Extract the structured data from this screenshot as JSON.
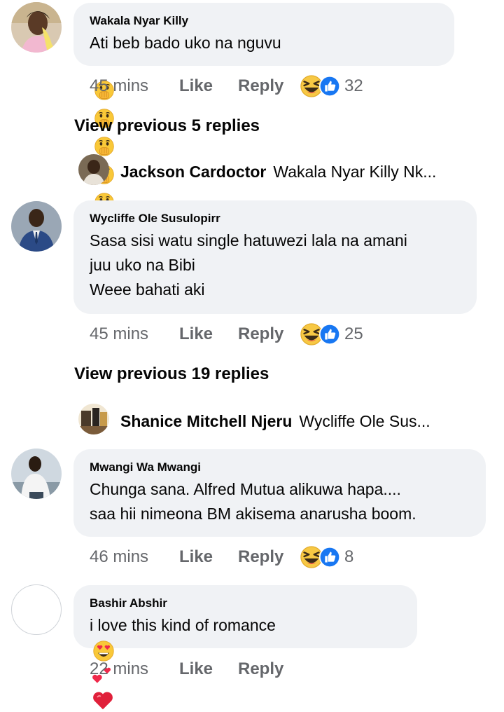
{
  "comments": [
    {
      "name": "Wakala Nyar Killy",
      "text": "Ati beb bado uko na nguvu",
      "emoji_note": "face-with-hand-over-mouth x5",
      "time": "45 mins",
      "like": "Like",
      "reply": "Reply",
      "reaction_count": "32"
    },
    {
      "name": "Wycliffe Ole Susulopirr",
      "text": "Sasa sisi watu single hatuwezi lala na amani\njuu uko na Bibi\nWeee bahati aki",
      "time": "45 mins",
      "like": "Like",
      "reply": "Reply",
      "reaction_count": "25"
    },
    {
      "name": "Mwangi Wa Mwangi",
      "text": "Chunga sana. Alfred Mutua alikuwa hapa....\nsaa hii nimeona BM akisema anarusha boom.",
      "time": "46 mins",
      "like": "Like",
      "reply": "Reply",
      "reaction_count": "8"
    },
    {
      "name": "Bashir Abshir",
      "text": "i love this kind of romance",
      "time": "22 mins",
      "like": "Like",
      "reply": "Reply"
    }
  ],
  "view_previous": [
    "View previous 5 replies",
    "View previous 19 replies"
  ],
  "nested_replies": [
    {
      "name": "Jackson Cardoctor",
      "preview": "Wakala Nyar Killy Nk..."
    },
    {
      "name": "Shanice Mitchell Njeru",
      "preview": "Wycliffe Ole Sus..."
    }
  ],
  "colors": {
    "bubble": "#f0f2f5",
    "meta_text": "#65676b",
    "like_blue": "#1877f2",
    "haha_yellow": "#f7c844",
    "heart_red": "#f0284a"
  },
  "icons": {
    "like_reaction": "like-reaction-icon",
    "haha_reaction": "haha-reaction-icon",
    "shush_emoji": "face-hand-over-mouth-icon",
    "heart_eyes": "heart-eyes-emoji-icon",
    "two_hearts": "two-hearts-emoji-icon",
    "red_heart": "red-heart-emoji-icon"
  }
}
